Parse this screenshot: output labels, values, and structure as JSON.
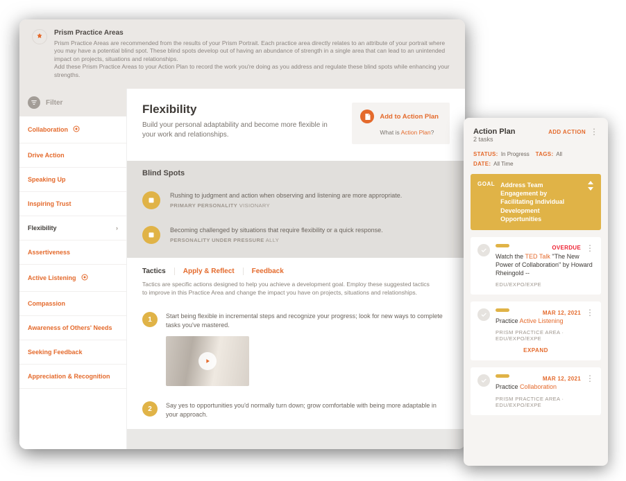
{
  "banner": {
    "title": "Prism Practice Areas",
    "line1": "Prism Practice Areas are recommended from the results of your Prism Portrait. Each practice area directly relates to an attribute of your portrait where you may have a potential blind spot. These blind spots develop out of having an abundance of strength in a single area that can lead to an unintended impact on projects, situations and relationships.",
    "line2": "Add these Prism Practice Areas to your Action Plan to record the work you're doing as you address and regulate these blind spots while enhancing your strengths."
  },
  "sidebar": {
    "filter_label": "Filter",
    "items": [
      {
        "label": "Collaboration",
        "icon": true
      },
      {
        "label": "Drive Action"
      },
      {
        "label": "Speaking Up"
      },
      {
        "label": "Inspiring Trust"
      },
      {
        "label": "Flexibility",
        "active": true
      },
      {
        "label": "Assertiveness"
      },
      {
        "label": "Active Listening",
        "icon": true
      },
      {
        "label": "Compassion"
      },
      {
        "label": "Awareness of Others' Needs"
      },
      {
        "label": "Seeking Feedback"
      },
      {
        "label": "Appreciation & Recognition"
      }
    ]
  },
  "hero": {
    "title": "Flexibility",
    "desc": "Build your personal adaptability and become more flexible in your work and relationships.",
    "add_label": "Add to Action Plan",
    "whatis_pre": "What is ",
    "whatis_link": "Action Plan",
    "whatis_post": "?"
  },
  "blind": {
    "heading": "Blind Spots",
    "items": [
      {
        "text": "Rushing to judgment and action when observing and listening are more appropriate.",
        "meta_label": "PRIMARY PERSONALITY",
        "meta_value": "VISIONARY"
      },
      {
        "text": "Becoming challenged by situations that require flexibility or a quick response.",
        "meta_label": "PERSONALITY UNDER PRESSURE",
        "meta_value": "ALLY"
      }
    ]
  },
  "tabs": {
    "items": [
      "Tactics",
      "Apply & Reflect",
      "Feedback"
    ],
    "desc": "Tactics are specific actions designed to help you achieve a development goal. Employ these suggested tactics to improve in this Practice Area and change the impact you have on projects, situations and relationships."
  },
  "tactics": [
    {
      "num": "1",
      "text": "Start being flexible in incremental steps and recognize your progress; look for new ways to complete tasks you've mastered."
    },
    {
      "num": "2",
      "text": "Say yes to opportunities you'd normally turn down; grow comfortable with being more adaptable in your approach."
    }
  ],
  "mobile": {
    "title": "Action Plan",
    "subtitle": "2 tasks",
    "add_action": "ADD ACTION",
    "filters": {
      "status_label": "STATUS:",
      "status_value": "In Progress",
      "tags_label": "TAGS:",
      "tags_value": "All",
      "date_label": "DATE:",
      "date_value": "All Time"
    },
    "goal": {
      "label": "GOAL",
      "text": "Address Team Engagement by Facilitating Individual Development Opportunities"
    },
    "tasks": [
      {
        "date": "OVERDUE",
        "overdue": true,
        "title_pre": "Watch the ",
        "title_hl": "TED Talk",
        "title_post": " \"The New Power of Collaboration\" by Howard Rheingold --",
        "meta": "EDU/EXPO/EXPE"
      },
      {
        "date": "MAR 12, 2021",
        "title_pre": "Practice ",
        "title_hl": "Active Listening",
        "title_post": "",
        "meta": "PRISM PRACTICE AREA · EDU/EXPO/EXPE",
        "expand": "EXPAND"
      },
      {
        "date": "MAR 12, 2021",
        "title_pre": "Practice ",
        "title_hl": "Collaboration",
        "title_post": "",
        "meta": "PRISM PRACTICE AREA · EDU/EXPO/EXPE"
      }
    ]
  }
}
